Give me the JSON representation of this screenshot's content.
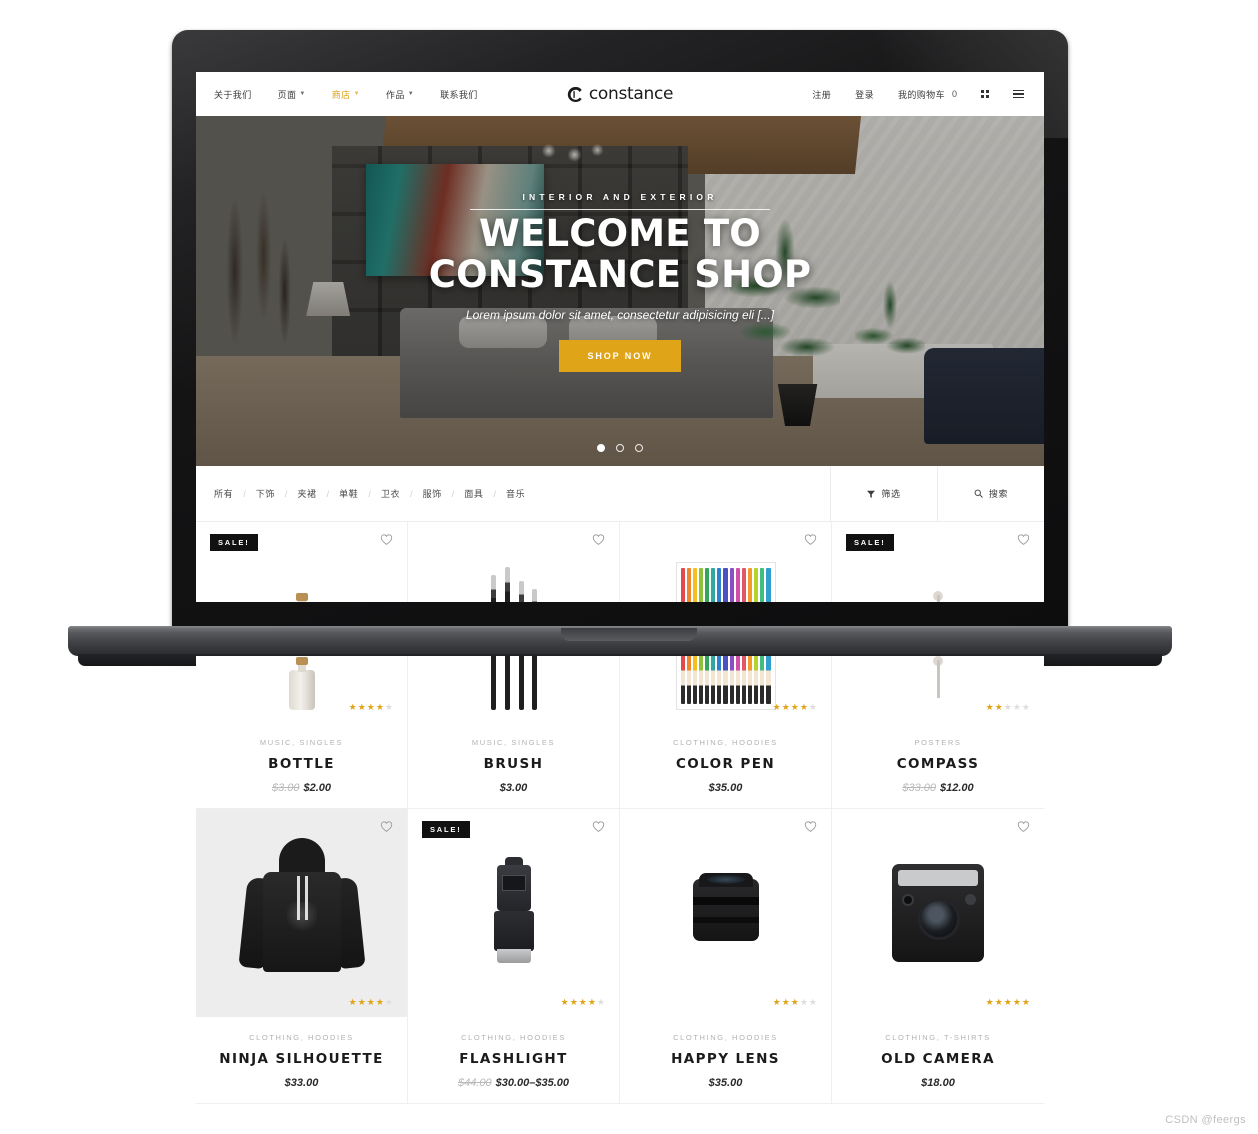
{
  "site": {
    "brand_name": "constance",
    "brand_mark": "c-monogram-icon"
  },
  "header": {
    "nav_left": [
      {
        "label": "关于我们",
        "has_caret": false,
        "active": false
      },
      {
        "label": "页面",
        "has_caret": true,
        "active": false
      },
      {
        "label": "商店",
        "has_caret": true,
        "active": true
      },
      {
        "label": "作品",
        "has_caret": true,
        "active": false
      },
      {
        "label": "联系我们",
        "has_caret": false,
        "active": false
      }
    ],
    "nav_right": [
      {
        "label": "注册",
        "name": "register-link"
      },
      {
        "label": "登录",
        "name": "login-link"
      }
    ],
    "cart": {
      "label": "我的购物车",
      "count": "0"
    },
    "grid_icon": "grid-view-icon",
    "menu_icon": "hamburger-menu-icon"
  },
  "hero": {
    "eyebrow": "INTERIOR AND EXTERIOR",
    "title_line1": "WELCOME TO",
    "title_line2": "CONSTANCE SHOP",
    "subtitle": "Lorem ipsum dolor sit amet, consectetur adipisicing eli [...]",
    "cta_label": "SHOP NOW",
    "slides": [
      {
        "active": true
      },
      {
        "active": false
      },
      {
        "active": false
      }
    ]
  },
  "filter_bar": {
    "categories": [
      "所有",
      "下饰",
      "夹裙",
      "单鞋",
      "卫衣",
      "服饰",
      "面具",
      "音乐"
    ],
    "separator": "/",
    "filter": {
      "label": "筛选",
      "icon": "filter-icon"
    },
    "search": {
      "label": "搜索",
      "icon": "search-icon"
    }
  },
  "products": [
    {
      "name": "BOTTLE",
      "categories": "MUSIC, SINGLES",
      "price_was": "$3.00",
      "price_now": "$2.00",
      "on_sale": true,
      "rating": 4,
      "rating_max": 5,
      "hovered": false,
      "art": "bottle",
      "wishlist_icon": "heart-icon"
    },
    {
      "name": "BRUSH",
      "categories": "MUSIC, SINGLES",
      "price_was": "",
      "price_now": "$3.00",
      "on_sale": false,
      "rating": 0,
      "rating_max": 5,
      "hovered": false,
      "art": "brushes",
      "wishlist_icon": "heart-icon"
    },
    {
      "name": "COLOR PEN",
      "categories": "CLOTHING, HOODIES",
      "price_was": "",
      "price_now": "$35.00",
      "on_sale": false,
      "rating": 4,
      "rating_max": 5,
      "hovered": false,
      "art": "pens",
      "wishlist_icon": "heart-icon"
    },
    {
      "name": "COMPASS",
      "categories": "POSTERS",
      "price_was": "$33.00",
      "price_now": "$12.00",
      "on_sale": true,
      "rating": 2,
      "rating_max": 5,
      "hovered": false,
      "art": "compass",
      "wishlist_icon": "heart-icon"
    },
    {
      "name": "NINJA SILHOUETTE",
      "categories": "CLOTHING, HOODIES",
      "price_was": "",
      "price_now": "$33.00",
      "on_sale": false,
      "rating": 4,
      "rating_max": 5,
      "hovered": true,
      "art": "hoodie",
      "wishlist_icon": "heart-icon"
    },
    {
      "name": "FLASHLIGHT",
      "categories": "CLOTHING, HOODIES",
      "price_was": "$44.00",
      "price_now": "$30.00–$35.00",
      "on_sale": true,
      "rating": 4,
      "rating_max": 5,
      "hovered": false,
      "art": "flash",
      "wishlist_icon": "heart-icon"
    },
    {
      "name": "HAPPY LENS",
      "categories": "CLOTHING, HOODIES",
      "price_was": "",
      "price_now": "$35.00",
      "on_sale": false,
      "rating": 3,
      "rating_max": 5,
      "hovered": false,
      "art": "lens",
      "wishlist_icon": "heart-icon"
    },
    {
      "name": "OLD CAMERA",
      "categories": "CLOTHING, T-SHIRTS",
      "price_was": "",
      "price_now": "$18.00",
      "on_sale": false,
      "rating": 5,
      "rating_max": 5,
      "hovered": false,
      "art": "camera-prod",
      "wishlist_icon": "heart-icon"
    }
  ],
  "colors": {
    "accent": "#e0a419",
    "text_dark": "#1b1b1b",
    "muted": "#b2b2b2",
    "sale_badge_bg": "#111111"
  },
  "watermark": "CSDN @feergs",
  "pen_colors": [
    "#e24a4a",
    "#f0862a",
    "#f4c020",
    "#8fc13f",
    "#2fa85c",
    "#2ea8a0",
    "#2f7fd0",
    "#4b4fc4",
    "#8a4fc4",
    "#d04fa8",
    "#e2566a",
    "#f29b2a",
    "#b8d12f",
    "#3fbf7f",
    "#2f9fd0"
  ]
}
